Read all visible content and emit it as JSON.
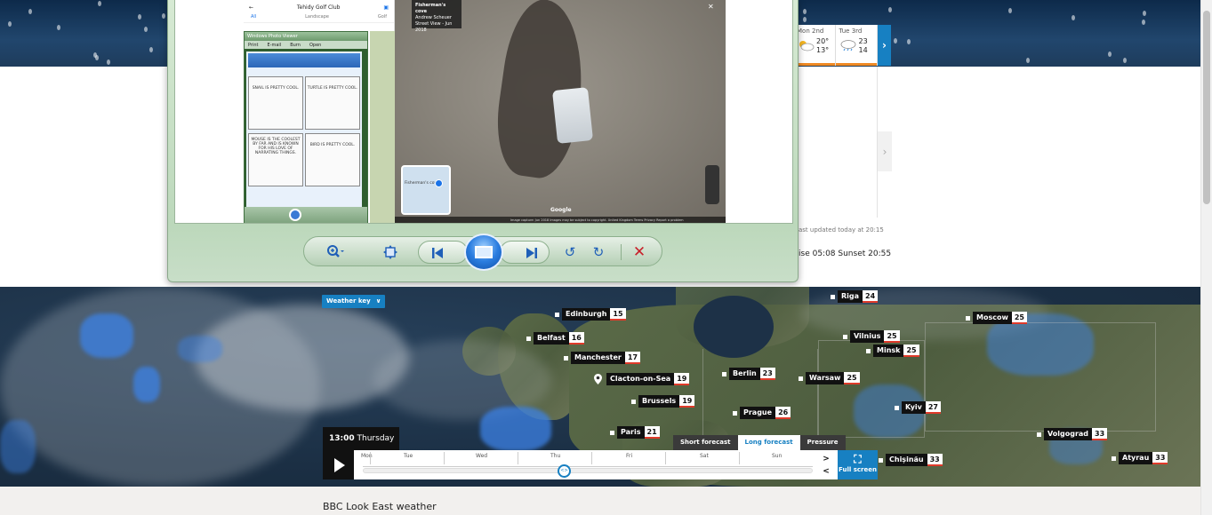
{
  "forecast": {
    "days": [
      {
        "name": "Mon",
        "date": "2nd",
        "high": "20°",
        "low": "13°",
        "icon": "sun-cloud-icon"
      },
      {
        "name": "Tue",
        "date": "3rd",
        "high": "23",
        "low": "14",
        "icon": "cloud-rain-icon"
      }
    ],
    "next_label": "›",
    "side_arrow": "›",
    "updated": "ast updated today at 20:15",
    "sun_times": "ise 05:08 Sunset 20:55"
  },
  "viewer": {
    "phone": {
      "title": "Tehidy Golf Club",
      "back_icon": "back-arrow-icon",
      "tabs": [
        "All",
        "Landscape",
        "Golf"
      ],
      "mini_title": "Windows Photo Viewer",
      "mini_menu": [
        "Print",
        "E-mail",
        "Burn",
        "Open"
      ],
      "comics": [
        "SNAIL IS PRETTY COOL.",
        "TURTLE IS PRETTY COOL.",
        "MOUSE IS THE COOLEST BY FAR AND IS KNOWN FOR HIS LOVE OF NARRATING THINGS.",
        "BIRD IS PRETTY COOL."
      ]
    },
    "streetview": {
      "card_title": "Fisherman's cove",
      "card_author": "Andrew Scheuer",
      "card_date": "Street View - Jun 2018",
      "map_label": "Fisherman's cove",
      "google": "Google",
      "footer": "Image capture: Jun 2018   Images may be subject to copyright.   United Kingdom   Terms   Privacy   Report a problem"
    }
  },
  "map": {
    "weather_key": "Weather key",
    "cities": [
      {
        "name": "Edinburgh",
        "temp": "15"
      },
      {
        "name": "Belfast",
        "temp": "16"
      },
      {
        "name": "Manchester",
        "temp": "17"
      },
      {
        "name": "Clacton-on-Sea",
        "temp": "19"
      },
      {
        "name": "Brussels",
        "temp": "19"
      },
      {
        "name": "Paris",
        "temp": "21"
      },
      {
        "name": "Berlin",
        "temp": "23"
      },
      {
        "name": "Prague",
        "temp": "26"
      },
      {
        "name": "Warsaw",
        "temp": "25"
      },
      {
        "name": "Riga",
        "temp": "24"
      },
      {
        "name": "Vilnius",
        "temp": "25"
      },
      {
        "name": "Minsk",
        "temp": "25"
      },
      {
        "name": "Moscow",
        "temp": "25"
      },
      {
        "name": "Kyiv",
        "temp": "27"
      },
      {
        "name": "Volgograd",
        "temp": "33"
      },
      {
        "name": "Chișinău",
        "temp": "33"
      },
      {
        "name": "Atyrau",
        "temp": "33"
      }
    ],
    "time_label_time": "13:00",
    "time_label_day": "Thursday",
    "timeline_days": [
      "Mon",
      "Tue",
      "Wed",
      "Thu",
      "Fri",
      "Sat",
      "Sun"
    ],
    "handle": "<>",
    "arrow_next": ">",
    "arrow_prev": "<",
    "tabs": [
      {
        "label": "Short forecast",
        "active": false
      },
      {
        "label": "Long forecast",
        "active": true
      },
      {
        "label": "Pressure",
        "active": false
      }
    ],
    "fullscreen": "Full screen"
  },
  "footer": {
    "title": "BBC Look East weather"
  },
  "colors": {
    "accent": "#1780c2",
    "temp_underline": "#e03a2a",
    "forecast_bar": "#f08a24"
  }
}
